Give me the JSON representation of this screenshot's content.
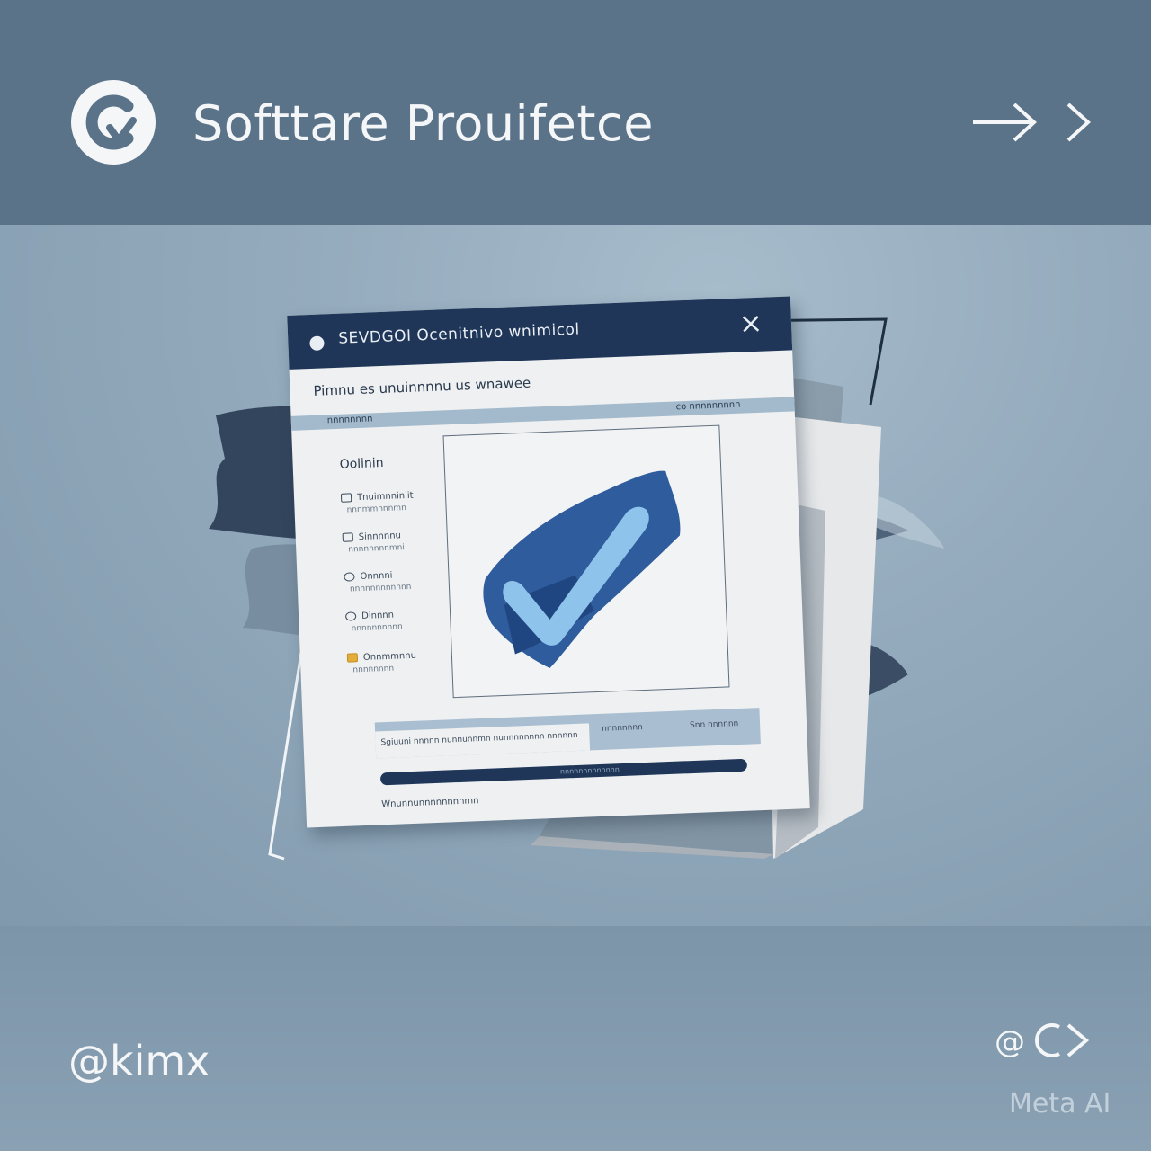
{
  "header": {
    "title": "Softtare Prouifetce",
    "logo_icon": "brand-logo-icon",
    "nav_icons": [
      "arrow-right-icon",
      "chevron-right-icon"
    ]
  },
  "dialog": {
    "title": "SEVDGOI Ocenitnivo wnimicol",
    "heading": "Pimnu es unuinnnnu us wnawee",
    "band_left": "nnnnnnnn",
    "band_right": "co nnnnnnnnn",
    "sidebar_label": "Oolinin",
    "sidebar_items": [
      {
        "label": "Tnuimnniniit",
        "sub": "nnnmmnnnmn"
      },
      {
        "label": "Sinnnnnu",
        "sub": "nnnnnnnnmni"
      },
      {
        "label": "Onnnni",
        "sub": "nnnnnnnnnnnn"
      },
      {
        "label": "Dinnnn",
        "sub": "nnnnnnnnnn"
      },
      {
        "label": "Onnmmnnu",
        "sub": "nnnnnnnn"
      }
    ],
    "field_text": "Sgiuuni nnnnn nunnunnmn nunnnnnnnn nnnnnn",
    "col2": "nnnnnnnn",
    "col3": "Snn nnnnnn",
    "progress_label": "nnnnnnnnnnnnn",
    "footnote": "Wnunnunnnnnnnnmn",
    "close_icon": "close-icon",
    "preview_icon": "checkmark-icon"
  },
  "footer": {
    "handle": "@kimx",
    "mark_icon": "brand-mark-icon",
    "watermark": "Meta AI"
  },
  "colors": {
    "header_bg": "#5a7389",
    "dialog_bar": "#1f3658",
    "accent_blue": "#2f5c9c",
    "check_light": "#8ec3ec"
  }
}
